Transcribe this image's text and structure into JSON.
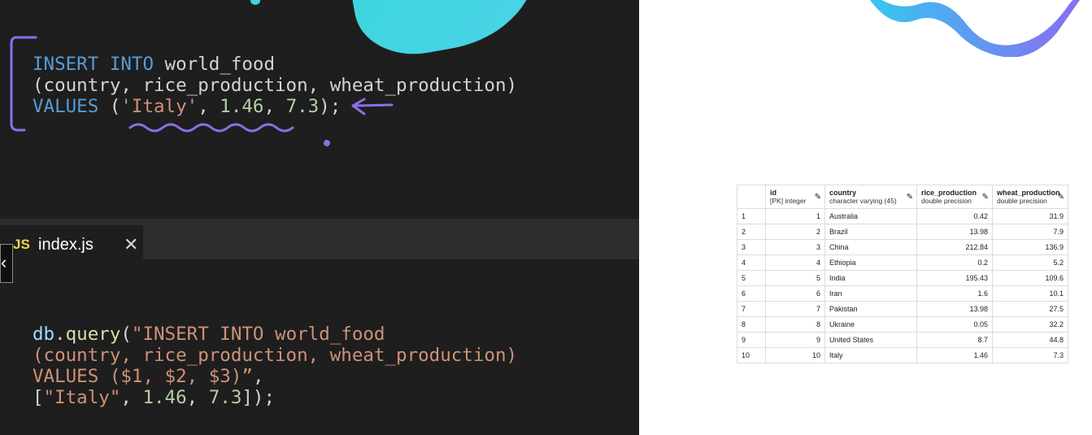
{
  "colors": {
    "editor_bg": "#1e1e1e",
    "keyword": "#569cd6",
    "string": "#ce9178",
    "number": "#b5cea8",
    "annotation_purple": "#8e6ee8",
    "blob_cyan": "#3bd6d9"
  },
  "snippet1": {
    "line1_kw": "INSERT INTO",
    "line1_rest": " world_food",
    "line2": "(country, rice_production, wheat_production)",
    "line3_kw": "VALUES",
    "line3_open": " (",
    "line3_str": "'Italy'",
    "line3_comma1": ", ",
    "line3_n1": "1.46",
    "line3_comma2": ", ",
    "line3_n2": "7.3",
    "line3_close": ");"
  },
  "tab": {
    "icon_text": "JS",
    "label": "index.js",
    "close_glyph": "✕",
    "back_glyph": "‹"
  },
  "snippet2": {
    "obj": "db",
    "dot": ".",
    "method": "query",
    "open": "(",
    "line1_str": "\"INSERT INTO world_food",
    "line2_str": "(country, rice_production, wheat_production)",
    "line3_str": "VALUES ($1, $2, $3)”",
    "line3_comma": ",",
    "line4_open": "[",
    "line4_str": "\"Italy\"",
    "line4_c1": ", ",
    "line4_n1": "1.46",
    "line4_c2": ", ",
    "line4_n2": "7.3",
    "line4_close": "]);"
  },
  "table": {
    "columns": [
      {
        "name": "id",
        "type": "[PK] integer"
      },
      {
        "name": "country",
        "type": "character varying (45)"
      },
      {
        "name": "rice_production",
        "type": "double precision"
      },
      {
        "name": "wheat_production",
        "type": "double precision"
      }
    ],
    "rows": [
      {
        "rn": "1",
        "id": "1",
        "country": "Australia",
        "rice": "0.42",
        "wheat": "31.9"
      },
      {
        "rn": "2",
        "id": "2",
        "country": "Brazil",
        "rice": "13.98",
        "wheat": "7.9"
      },
      {
        "rn": "3",
        "id": "3",
        "country": "China",
        "rice": "212.84",
        "wheat": "136.9"
      },
      {
        "rn": "4",
        "id": "4",
        "country": "Ethiopia",
        "rice": "0.2",
        "wheat": "5.2"
      },
      {
        "rn": "5",
        "id": "5",
        "country": "India",
        "rice": "195.43",
        "wheat": "109.6"
      },
      {
        "rn": "6",
        "id": "6",
        "country": "Iran",
        "rice": "1.6",
        "wheat": "10.1"
      },
      {
        "rn": "7",
        "id": "7",
        "country": "Pakistan",
        "rice": "13.98",
        "wheat": "27.5"
      },
      {
        "rn": "8",
        "id": "8",
        "country": "Ukraine",
        "rice": "0.05",
        "wheat": "32.2"
      },
      {
        "rn": "9",
        "id": "9",
        "country": "United States",
        "rice": "8.7",
        "wheat": "44.8"
      },
      {
        "rn": "10",
        "id": "10",
        "country": "Italy",
        "rice": "1.46",
        "wheat": "7.3"
      }
    ]
  }
}
